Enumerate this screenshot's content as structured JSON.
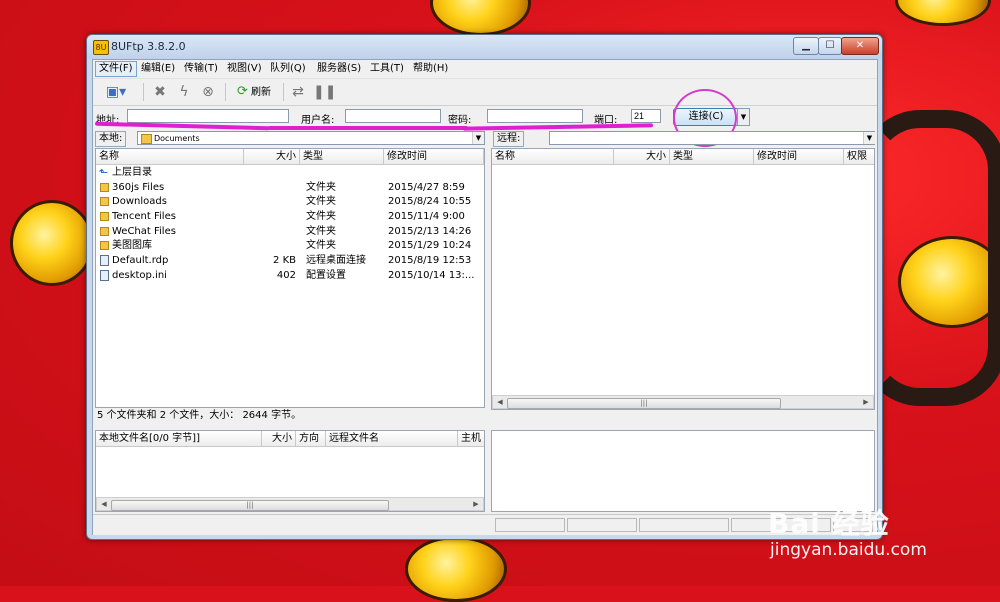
{
  "window": {
    "title": "8UFtp 3.8.2.0"
  },
  "menu": [
    {
      "label": "文件(F)"
    },
    {
      "label": "编辑(E)"
    },
    {
      "label": "传输(T)"
    },
    {
      "label": "视图(V)"
    },
    {
      "label": "队列(Q)"
    },
    {
      "label": "服务器(S)"
    },
    {
      "label": "工具(T)"
    },
    {
      "label": "帮助(H)"
    }
  ],
  "toolbar": {
    "refresh_label": "刷新"
  },
  "connection": {
    "address_label": "地址:",
    "address_value": "",
    "username_label": "用户名:",
    "username_value": "",
    "password_label": "密码:",
    "password_value": "",
    "port_label": "端口:",
    "port_value": "21",
    "connect_label": "连接(C)"
  },
  "local": {
    "path_label": "本地:",
    "path_value": "Documents",
    "columns": [
      "名称",
      "大小",
      "类型",
      "修改时间"
    ],
    "rows": [
      {
        "name": "上层目录",
        "size": "",
        "type": "",
        "modified": "",
        "icon": "up"
      },
      {
        "name": "360js Files",
        "size": "",
        "type": "文件夹",
        "modified": "2015/4/27 8:59",
        "icon": "folder"
      },
      {
        "name": "Downloads",
        "size": "",
        "type": "文件夹",
        "modified": "2015/8/24 10:55",
        "icon": "folder"
      },
      {
        "name": "Tencent Files",
        "size": "",
        "type": "文件夹",
        "modified": "2015/11/4 9:00",
        "icon": "folder"
      },
      {
        "name": "WeChat Files",
        "size": "",
        "type": "文件夹",
        "modified": "2015/2/13 14:26",
        "icon": "folder"
      },
      {
        "name": "美图图库",
        "size": "",
        "type": "文件夹",
        "modified": "2015/1/29 10:24",
        "icon": "folder"
      },
      {
        "name": "Default.rdp",
        "size": "2 KB",
        "type": "远程桌面连接",
        "modified": "2015/8/19 12:53",
        "icon": "file"
      },
      {
        "name": "desktop.ini",
        "size": "402",
        "type": "配置设置",
        "modified": "2015/10/14 13:...",
        "icon": "file"
      }
    ],
    "status": "5 个文件夹和 2 个文件，大小： 2644 字节。"
  },
  "remote": {
    "path_label": "远程:",
    "path_value": "",
    "columns": [
      "名称",
      "大小",
      "类型",
      "修改时间",
      "权限"
    ]
  },
  "queue": {
    "columns": [
      "本地文件名[0/0 字节]]",
      "大小",
      "方向",
      "远程文件名",
      "主机"
    ]
  },
  "watermark": {
    "brand": "Bai 经验",
    "url": "jingyan.baidu.com"
  },
  "colors": {
    "background": "#d8111a",
    "annotation": "#e020d0"
  }
}
